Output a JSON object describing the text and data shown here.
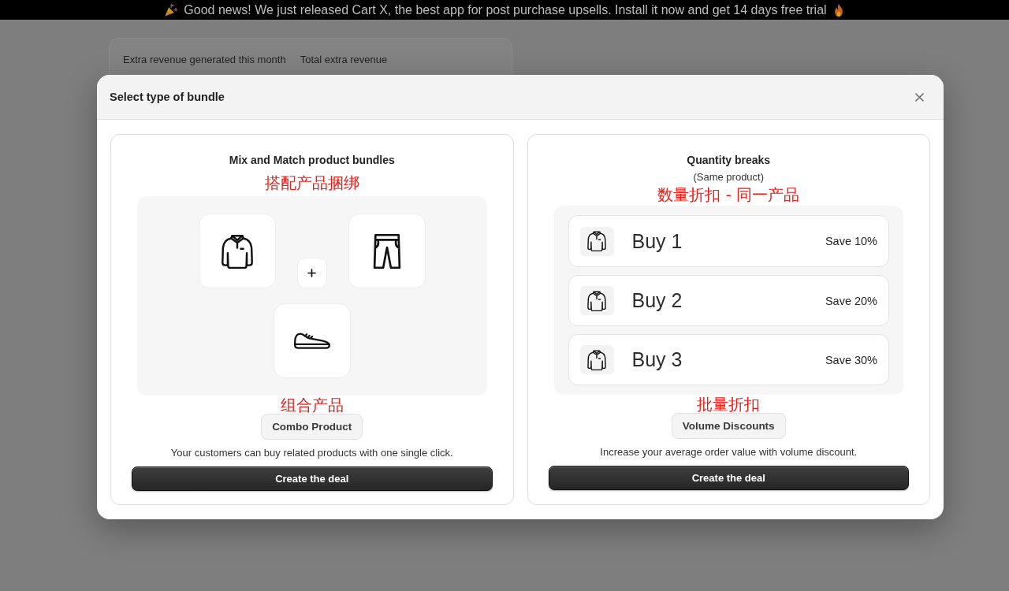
{
  "announcement_bar": {
    "text": "Good news! We just released Cart X, the best app for post purchase upsells. Install it now and get 14 days free trial"
  },
  "stats_card": {
    "labels": [
      "Extra revenue generated this month",
      "Total extra revenue"
    ]
  },
  "modal": {
    "title": "Select type of bundle",
    "options": [
      {
        "kind": "mix_and_match",
        "title": "Mix and Match product bundles",
        "annotation": "搭配产品捆绑",
        "tag_annotation": "组合产品",
        "tag": "Combo Product",
        "description": "Your customers can buy related products with one single click.",
        "button": "Create the deal"
      },
      {
        "kind": "quantity_breaks",
        "title": "Quantity breaks",
        "subtitle": "(Same product)",
        "annotation": "数量折扣 - 同一产品",
        "tiers": [
          {
            "label": "Buy 1",
            "saving": "Save 10%"
          },
          {
            "label": "Buy 2",
            "saving": "Save 20%"
          },
          {
            "label": "Buy 3",
            "saving": "Save 30%"
          }
        ],
        "tag_annotation": "批量折扣",
        "tag": "Volume Discounts",
        "description": "Increase your average order value with volume discount.",
        "button": "Create the deal"
      }
    ]
  }
}
